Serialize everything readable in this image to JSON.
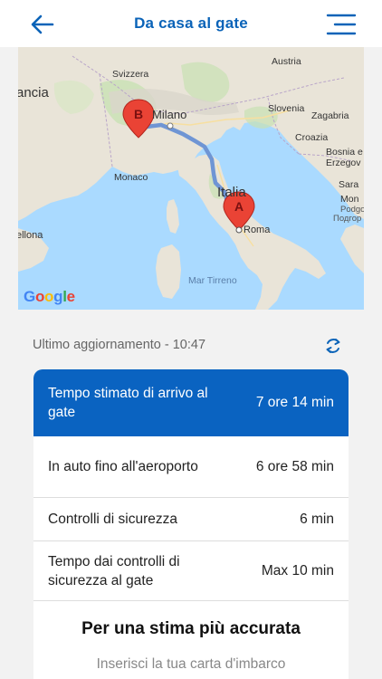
{
  "header": {
    "title": "Da casa al gate",
    "back_icon": "arrow-left-icon",
    "menu_icon": "hamburger-menu-icon",
    "accent_color": "#0a63b8"
  },
  "map": {
    "labels": {
      "austria": "Austria",
      "svizzera": "Svizzera",
      "francia": "ancia",
      "milano": "Milano",
      "slovenia": "Slovenia",
      "zagabria": "Zagabria",
      "croazia": "Croazia",
      "bosnia": "Bosnia e",
      "erzegovina": "Erzegov",
      "monaco": "Monaco",
      "italia": "Italia",
      "roma": "Roma",
      "sara": "Sara",
      "mon": "Mon",
      "podgor": "Podgo",
      "podgor_cyr": "Подгор",
      "barcellona": "ellona",
      "mar_tirreno": "Mar Tirreno",
      "google": "Google"
    },
    "markers": [
      "A",
      "B"
    ]
  },
  "status": {
    "updated": "Ultimo aggiornamento - 10:47",
    "refresh_icon": "refresh-icon"
  },
  "summary": {
    "rows": [
      {
        "label": "Tempo stimato di arrivo al gate",
        "value": "7 ore 14 min"
      },
      {
        "label": "In auto fino all'aeroporto",
        "value": "6 ore 58 min"
      },
      {
        "label": "Controlli di sicurezza",
        "value": "6 min"
      },
      {
        "label": "Tempo dai controlli di sicurezza al gate",
        "value": "Max 10 min"
      }
    ],
    "highlight_color": "#0a63c1"
  },
  "cta": {
    "title": "Per una stima più accurata",
    "subtitle": "Inserisci la tua carta d'imbarco"
  }
}
